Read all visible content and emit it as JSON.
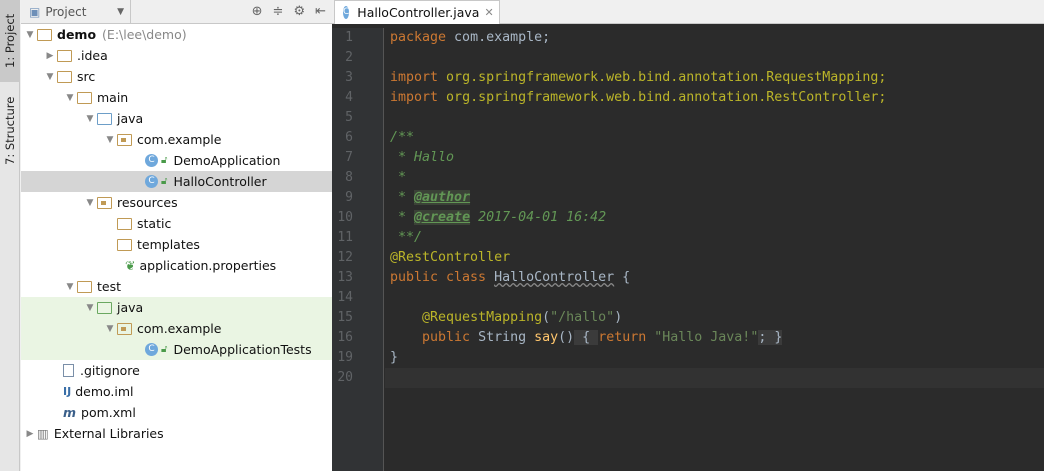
{
  "toolstrip": {
    "project": "1: Project",
    "structure": "7: Structure"
  },
  "project": {
    "selector": "Project",
    "tree": [
      {
        "label": "demo",
        "path": "(E:\\lee\\demo)"
      },
      {
        "label": ".idea"
      },
      {
        "label": "src"
      },
      {
        "label": "main"
      },
      {
        "label": "java"
      },
      {
        "label": "com.example"
      },
      {
        "label": "DemoApplication"
      },
      {
        "label": "HalloController"
      },
      {
        "label": "resources"
      },
      {
        "label": "static"
      },
      {
        "label": "templates"
      },
      {
        "label": "application.properties"
      },
      {
        "label": "test"
      },
      {
        "label": "java"
      },
      {
        "label": "com.example"
      },
      {
        "label": "DemoApplicationTests"
      },
      {
        "label": ".gitignore"
      },
      {
        "label": "demo.iml"
      },
      {
        "label": "pom.xml"
      },
      {
        "label": "External Libraries"
      }
    ]
  },
  "editor": {
    "tab": "HalloController.java",
    "line_numbers": [
      "1",
      "2",
      "3",
      "4",
      "5",
      "6",
      "7",
      "8",
      "9",
      "10",
      "11",
      "12",
      "13",
      "14",
      "15",
      "16",
      "19",
      "20"
    ],
    "code": {
      "l1a": "package",
      "l1b": " com.example;",
      "l3a": "import",
      "l3b": " org.springframework.web.bind.annotation.RequestMapping;",
      "l4a": "import",
      "l4b": " org.springframework.web.bind.annotation.RestController;",
      "l6": "/**",
      "l7": " * Hallo",
      "l8": " *",
      "l9a": " * ",
      "l9b": "@author",
      "l10a": " * ",
      "l10b": "@create",
      "l10c": " 2017-04-01 16:42",
      "l11": " **/",
      "l12": "@RestController",
      "l13a": "public class ",
      "l13b": "HalloController",
      "l13c": " {",
      "l15a": "    ",
      "l15b": "@RequestMapping",
      "l15c": "(",
      "l15d": "\"/hallo\"",
      "l15e": ")",
      "l16a": "    ",
      "l16b": "public ",
      "l16c": "String ",
      "l16d": "say",
      "l16e": "()",
      "l16f": " { ",
      "l16g": "return ",
      "l16h": "\"Hallo Java!\"",
      "l16i": "; }",
      "l19": "}"
    }
  }
}
